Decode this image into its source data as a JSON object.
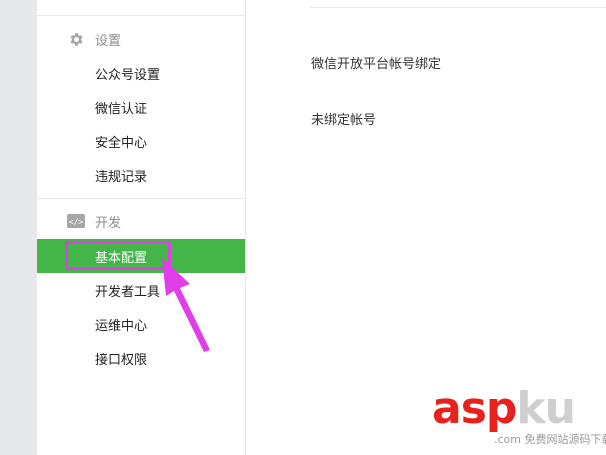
{
  "sidebar": {
    "settings_group": {
      "title": "设置",
      "icon": "gear-icon",
      "items": [
        {
          "label": "公众号设置"
        },
        {
          "label": "微信认证"
        },
        {
          "label": "安全中心"
        },
        {
          "label": "违规记录"
        }
      ]
    },
    "dev_group": {
      "title": "开发",
      "icon": "code-icon",
      "items": [
        {
          "label": "基本配置",
          "active": true
        },
        {
          "label": "开发者工具"
        },
        {
          "label": "运维中心"
        },
        {
          "label": "接口权限"
        }
      ]
    }
  },
  "main": {
    "binding_title": "微信开放平台帐号绑定",
    "binding_status": "未绑定帐号"
  },
  "watermark": {
    "brand_a": "asp",
    "brand_b": "ku",
    "suffix": ".com",
    "tagline": "免费网站源码下载站!"
  },
  "colors": {
    "accent": "#44b549",
    "annotation": "#e23ee7",
    "watermark_red": "#e8211c"
  }
}
